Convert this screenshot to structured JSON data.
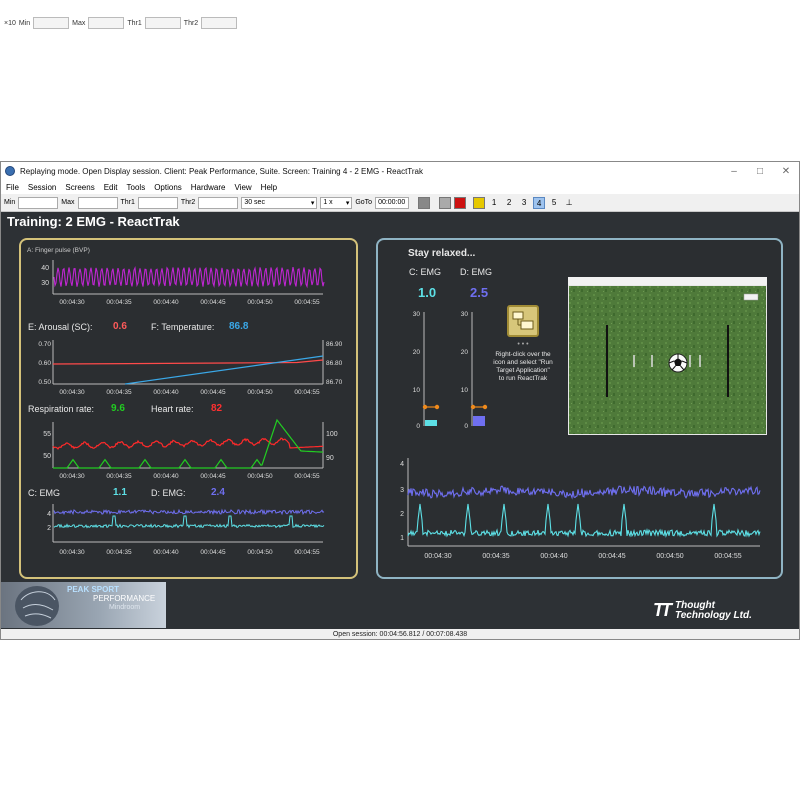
{
  "top_toolbar": {
    "scale": "×10",
    "min_label": "Min",
    "max_label": "Max",
    "thr1_label": "Thr1",
    "thr2_label": "Thr2"
  },
  "window": {
    "title": "Replaying mode. Open Display session. Client: Peak Performance, Suite. Screen: Training 4 - 2 EMG - ReactTrak",
    "controls": [
      "–",
      "□",
      "✕"
    ]
  },
  "menu": [
    "File",
    "Session",
    "Screens",
    "Edit",
    "Tools",
    "Options",
    "Hardware",
    "View",
    "Help"
  ],
  "toolbar": {
    "min_label": "Min",
    "max_label": "Max",
    "thr1_label": "Thr1",
    "thr2_label": "Thr2",
    "duration": "30 sec",
    "speed": "1 x",
    "goto_label": "GoTo",
    "goto_value": "00:00:00",
    "screen_numbers": [
      "1",
      "2",
      "3",
      "4",
      "5"
    ],
    "active_screen": "4",
    "colors": {
      "stop": "#888888",
      "record": "#cc1111",
      "pause": "#e6c800"
    }
  },
  "screen_title": "Training: 2 EMG - ReactTrak",
  "left_panel": {
    "bvp": {
      "title": "A: Finger pulse (BVP)",
      "y_ticks": [
        "40",
        "30"
      ],
      "x_ticks": [
        "00:04:30",
        "00:04:35",
        "00:04:40",
        "00:04:45",
        "00:04:50",
        "00:04:55"
      ],
      "color": "#c026d3"
    },
    "arousal": {
      "label": "E: Arousal (SC):",
      "value": "0.6",
      "color": "#ff5a5a"
    },
    "temperature": {
      "label": "F: Temperature:",
      "value": "86.8",
      "color": "#3aa8e8"
    },
    "sc_temp_chart": {
      "left_ticks": [
        "0.70",
        "0.60",
        "0.50"
      ],
      "right_ticks": [
        "86.90",
        "86.80",
        "86.70"
      ],
      "x_ticks": [
        "00:04:30",
        "00:04:35",
        "00:04:40",
        "00:04:45",
        "00:04:50",
        "00:04:55"
      ]
    },
    "respiration": {
      "label": "Respiration rate:",
      "value": "9.6",
      "color": "#22cc22"
    },
    "heart_rate": {
      "label": "Heart rate:",
      "value": "82",
      "color": "#ff3030"
    },
    "resp_hr_chart": {
      "left_ticks": [
        "55",
        "50"
      ],
      "right_ticks": [
        "100",
        "90"
      ],
      "x_ticks": [
        "00:04:30",
        "00:04:35",
        "00:04:40",
        "00:04:45",
        "00:04:50",
        "00:04:55"
      ]
    },
    "emg_c": {
      "label": "C: EMG",
      "value": "1.1",
      "color": "#5de0e6"
    },
    "emg_d": {
      "label": "D: EMG:",
      "value": "2.4",
      "color": "#6f6ff0"
    },
    "emg_chart": {
      "y_ticks": [
        "4",
        "2"
      ],
      "x_ticks": [
        "00:04:30",
        "00:04:35",
        "00:04:40",
        "00:04:45",
        "00:04:50",
        "00:04:55"
      ]
    }
  },
  "right_panel": {
    "prompt": "Stay relaxed...",
    "emg_c": {
      "label": "C: EMG",
      "value": "1.0",
      "color": "#5de0e6"
    },
    "emg_d": {
      "label": "D: EMG",
      "value": "2.5",
      "color": "#6f6ff0"
    },
    "bar_ticks": [
      "30",
      "20",
      "10",
      "0"
    ],
    "hint_dots": "• • •",
    "hint": "Right-click over the icon and select \"Run Target Application\" to run ReactTrak",
    "trend_chart": {
      "y_ticks": [
        "4",
        "3",
        "2",
        "1"
      ],
      "x_ticks": [
        "00:04:30",
        "00:04:35",
        "00:04:40",
        "00:04:45",
        "00:04:50",
        "00:04:55"
      ]
    }
  },
  "logo": {
    "line1": "PEAK SPORT",
    "line2": "PERFORMANCE",
    "line3": "Mindroom"
  },
  "brand": {
    "mark": "TT",
    "name_line1": "Thought",
    "name_line2": "Technology Ltd."
  },
  "status": "Open session: 00:04:56.812 / 00:07:08.438"
}
